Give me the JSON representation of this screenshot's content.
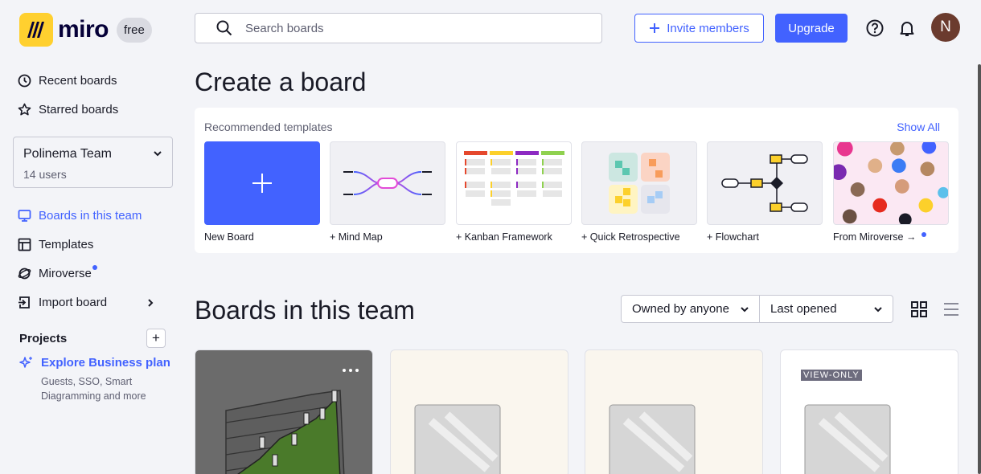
{
  "app": {
    "logo_text": "miro",
    "plan_badge": "free"
  },
  "header": {
    "search_placeholder": "Search boards",
    "invite_label": "Invite members",
    "upgrade_label": "Upgrade",
    "avatar_initial": "N"
  },
  "sidebar": {
    "recent": "Recent boards",
    "starred": "Starred boards",
    "team": {
      "name": "Polinema Team",
      "users": "14 users"
    },
    "boards_in_team": "Boards in this team",
    "templates": "Templates",
    "miroverse": "Miroverse",
    "import": "Import board",
    "projects_title": "Projects",
    "projects_add": "+",
    "explore_title": "Explore Business plan",
    "explore_sub_1": "Guests, SSO, Smart",
    "explore_sub_2": "Diagramming and more"
  },
  "main": {
    "create_title": "Create a board",
    "recommended_title": "Recommended templates",
    "show_all": "Show All",
    "templates": [
      {
        "label": "New Board"
      },
      {
        "label": "+ Mind Map"
      },
      {
        "label": "+ Kanban Framework"
      },
      {
        "label": "+ Quick Retrospective"
      },
      {
        "label": "+ Flowchart"
      },
      {
        "label": "From Miroverse →"
      }
    ],
    "boards_title": "Boards in this team",
    "owner_filter": "Owned by anyone",
    "sort_filter": "Last opened",
    "view_only_badge": "VIEW-ONLY"
  },
  "colors": {
    "accent": "#4262ff",
    "logo_yellow": "#ffd02f"
  }
}
